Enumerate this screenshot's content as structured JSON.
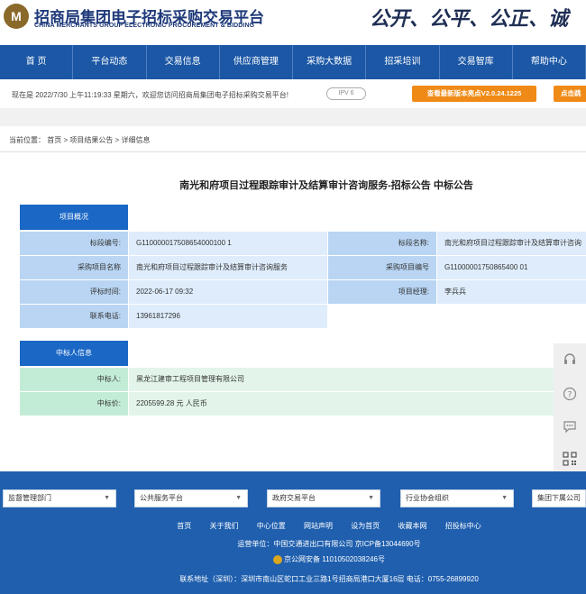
{
  "header": {
    "logo_mark": "M",
    "logo_cn": "招商局集团电子招标采购交易平台",
    "logo_en": "CHINA MERCHANTS GROUP ELECTRONIC PROCUREMENT & BIDDING",
    "slogan": "公开、公平、公正、诚"
  },
  "nav": {
    "items": [
      "首 页",
      "平台动态",
      "交易信息",
      "供应商管理",
      "采购大数据",
      "招采培训",
      "交易智库",
      "帮助中心"
    ]
  },
  "notice": {
    "text": "现在是 2022/7/30 上午11:19:33 星期六，欢迎您访问招商局集团电子招标采购交易平台!",
    "ipv6": "IPV 6",
    "new_version": "查看最新版本亮点V2.0.24.1225",
    "click": "点击跳"
  },
  "breadcrumb": "当前位置： 首页 > 项目结果公告 > 详细信息",
  "title": "南光和府项目过程跟踪审计及结算审计咨询服务-招标公告 中标公告",
  "project": {
    "tab": "项目概况",
    "rows": [
      {
        "l1": "标段编号:",
        "v1": "G110000017508654000100 1",
        "l2": "标段名称:",
        "v2": "南光和府项目过程跟踪审计及结算审计咨询"
      },
      {
        "l1": "采购项目名称",
        "v1": "南光和府项目过程跟踪审计及结算审计咨询服务",
        "l2": "采购项目编号",
        "v2": "G11000001750865400 01"
      },
      {
        "l1": "评标时间:",
        "v1": "2022-06-17 09:32",
        "l2": "项目经理:",
        "v2": "李兵兵"
      },
      {
        "l1": "联系电话:",
        "v1": "13961817296"
      }
    ]
  },
  "winner": {
    "tab": "中标人信息",
    "name_label": "中标人:",
    "name_value": "黑龙江建审工程项目管理有限公司",
    "price_label": "中标价:",
    "price_value": "2205599.28 元 人民币"
  },
  "sidebar": {
    "icons": [
      "headset-icon",
      "help-icon",
      "chat-icon",
      "qrcode-icon"
    ]
  },
  "footer": {
    "selects": [
      "监督管理部门",
      "公共服务平台",
      "政府交易平台",
      "行业协会组织",
      "集团下属公司"
    ],
    "links": [
      "首页",
      "关于我们",
      "中心位置",
      "网站声明",
      "设为首页",
      "收藏本网",
      "招投标中心"
    ],
    "operator": "运营单位：中国交通进出口有限公司    京ICP备13044690号",
    "police": "京公网安备 11010502038246号",
    "address": "联系地址（深圳）：深圳市南山区蛇口工业三路1号招商局港口大厦16层    电话：0755-26899920"
  }
}
